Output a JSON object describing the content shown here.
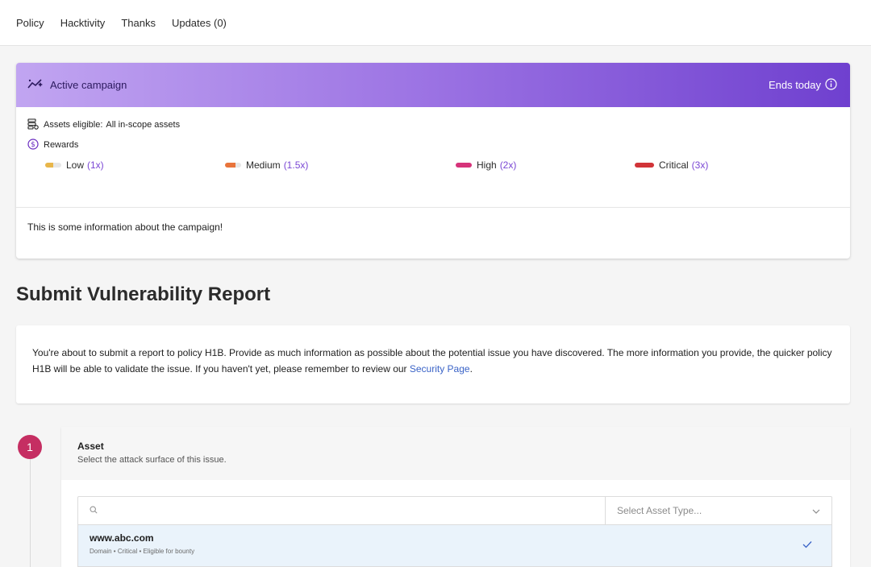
{
  "nav": {
    "policy": "Policy",
    "hacktivity": "Hacktivity",
    "thanks": "Thanks",
    "updates": "Updates (0)"
  },
  "campaign": {
    "title": "Active campaign",
    "ends": "Ends today",
    "assets_label": "Assets eligible:",
    "assets_value": "All in-scope assets",
    "rewards_label": "Rewards",
    "tiers": [
      {
        "name": "Low",
        "mult": "(1x)",
        "color": "#e8b64a"
      },
      {
        "name": "Medium",
        "mult": "(1.5x)",
        "color": "#e8743b"
      },
      {
        "name": "High",
        "mult": "(2x)",
        "color": "#d6337a"
      },
      {
        "name": "Critical",
        "mult": "(3x)",
        "color": "#d13438"
      }
    ],
    "info": "This is some information about the campaign!"
  },
  "page": {
    "title": "Submit Vulnerability Report"
  },
  "intro": {
    "text": "You're about to submit a report to policy H1B. Provide as much information as possible about the potential issue you have discovered. The more information you provide, the quicker policy H1B will be able to validate the issue. If you haven't yet, please remember to review our ",
    "link": "Security Page",
    "end": "."
  },
  "step": {
    "number": "1"
  },
  "asset": {
    "title": "Asset",
    "subtitle": "Select the attack surface of this issue.",
    "search_placeholder": "",
    "type_placeholder": "Select Asset Type...",
    "selected": {
      "name": "www.abc.com",
      "meta": "Domain  •  Critical  •  Eligible for bounty"
    }
  },
  "colors": {
    "accent": "#7a46d4",
    "step": "#c52e62",
    "link": "#3a63c7"
  }
}
